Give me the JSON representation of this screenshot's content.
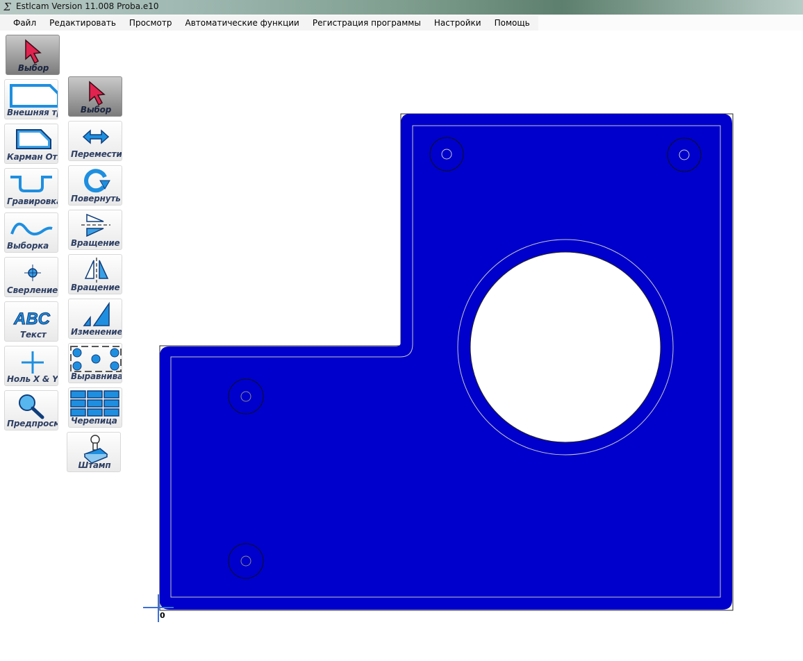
{
  "window": {
    "title": "Estlcam Version 11.008 Proba.e10",
    "icon": "estlcam-sigma-icon"
  },
  "menu": [
    {
      "label": "Файл"
    },
    {
      "label": "Редактировать"
    },
    {
      "label": "Просмотр"
    },
    {
      "label": "Автоматические функции"
    },
    {
      "label": "Регистрация программы"
    },
    {
      "label": "Настройки"
    },
    {
      "label": "Помощь"
    }
  ],
  "toolbar_left": [
    {
      "label": "Выбор",
      "icon": "select-arrow-icon",
      "active": true
    },
    {
      "label": "Внешняя тр",
      "icon": "outer-contour-icon"
    },
    {
      "label": "Карман Отве",
      "icon": "pocket-icon"
    },
    {
      "label": "Гравировка",
      "icon": "engrave-icon"
    },
    {
      "label": "Выборка",
      "icon": "carve-wave-icon"
    },
    {
      "label": "Сверление",
      "icon": "drill-crosshair-icon"
    },
    {
      "label": "Текст",
      "icon": "text-abc-icon",
      "glyph": "ABC"
    },
    {
      "label": "Ноль X & Y",
      "icon": "zero-xy-plus-icon"
    },
    {
      "label": "Предпросмо",
      "icon": "preview-magnifier-icon"
    }
  ],
  "toolbar_right": [
    {
      "label": "Выбор",
      "icon": "select-arrow-icon",
      "active": true
    },
    {
      "label": "Перемести",
      "icon": "move-arrows-icon"
    },
    {
      "label": "Повернуть",
      "icon": "rotate-icon"
    },
    {
      "label": "Вращение в",
      "icon": "mirror-horizontal-icon"
    },
    {
      "label": "Вращение в",
      "icon": "mirror-vertical-icon"
    },
    {
      "label": "Изменение р",
      "icon": "resize-icon"
    },
    {
      "label": "Выравниван",
      "icon": "align-icon"
    },
    {
      "label": "Черепица",
      "icon": "tile-grid-icon"
    },
    {
      "label": "Штамп",
      "icon": "stamp-icon"
    }
  ],
  "canvas": {
    "origin_label": "0",
    "part_color": "#0000cc",
    "outline_color": "#c8c8c8",
    "origin_marker_color": "#3a6fd8"
  }
}
